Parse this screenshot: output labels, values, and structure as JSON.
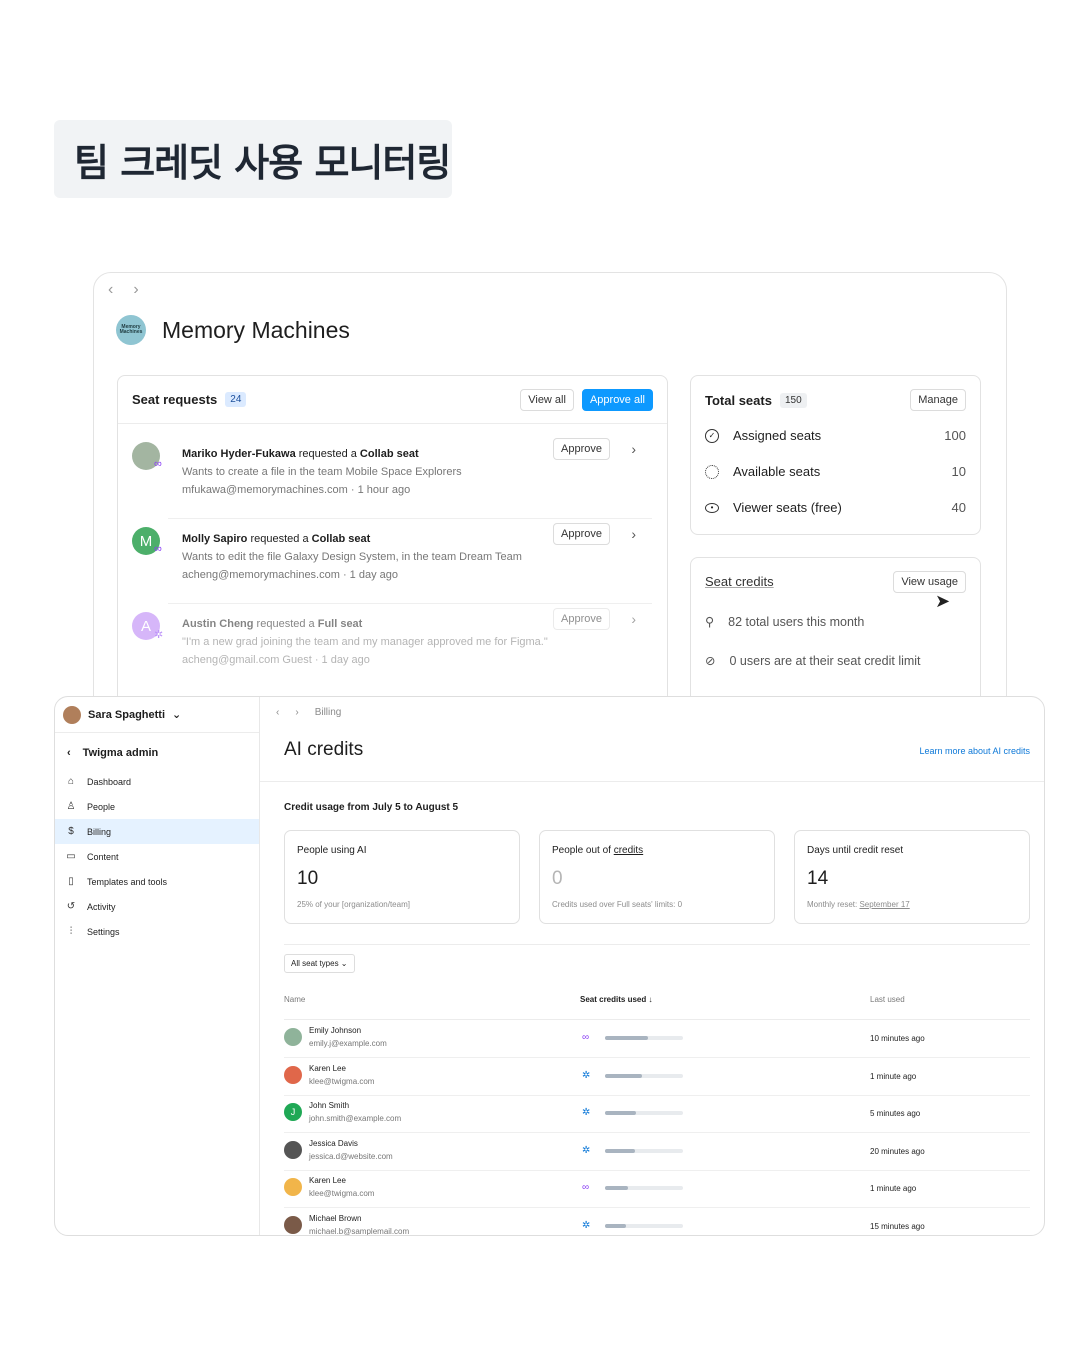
{
  "heading": "팀 크레딧 사용 모니터링",
  "back_window": {
    "nav": {
      "back": "‹",
      "forward": "›"
    },
    "org": {
      "logo_text": "Memory Machines",
      "name": "Memory Machines"
    },
    "seat_requests": {
      "title": "Seat requests",
      "count": "24",
      "view_all": "View all",
      "approve_all": "Approve all",
      "items": [
        {
          "name": "Mariko Hyder-Fukawa",
          "verb": " requested a ",
          "seat": "Collab seat",
          "note": "Wants to create a file in the team Mobile Space Explorers",
          "meta": "mfukawa@memorymachines.com · 1 hour ago",
          "approve": "Approve",
          "avatar_initial": "",
          "avatar_color": "#a3b5a1"
        },
        {
          "name": "Molly Sapiro",
          "verb": " requested a ",
          "seat": "Collab seat",
          "note": "Wants to edit the file Galaxy Design System, in the team Dream Team",
          "meta": "acheng@memorymachines.com · 1 day ago",
          "approve": "Approve",
          "avatar_initial": "M",
          "avatar_color": "#4caf6a"
        },
        {
          "name": "Austin Cheng",
          "verb": " requested a ",
          "seat": "Full seat",
          "note": "\"I'm a new grad joining the team and my manager approved me for Figma.\"",
          "meta": "acheng@gmail.com   Guest   · 1 day ago",
          "approve": "Approve",
          "avatar_initial": "A",
          "avatar_color": "#b57bf5"
        }
      ]
    },
    "total_seats": {
      "title": "Total seats",
      "count": "150",
      "manage": "Manage",
      "rows": [
        {
          "label": "Assigned seats",
          "value": "100",
          "icon": "check-circle-icon"
        },
        {
          "label": "Available seats",
          "value": "10",
          "icon": "dashed-circle-icon"
        },
        {
          "label": "Viewer seats (free)",
          "value": "40",
          "icon": "eye-icon"
        }
      ]
    },
    "seat_credits": {
      "title": "Seat credits",
      "view_usage": "View usage",
      "rows": [
        {
          "text": "82 total users this month",
          "icon": "user-icon"
        },
        {
          "text": "0 users are at their seat credit limit",
          "icon": "no-entry-icon"
        }
      ]
    }
  },
  "front_window": {
    "user": {
      "name": "Sara Spaghetti"
    },
    "sidebar": {
      "back_label": "Twigma admin",
      "items": [
        {
          "label": "Dashboard",
          "icon": "home-icon"
        },
        {
          "label": "People",
          "icon": "user-icon"
        },
        {
          "label": "Billing",
          "icon": "dollar-icon",
          "active": true
        },
        {
          "label": "Content",
          "icon": "folder-icon"
        },
        {
          "label": "Templates and tools",
          "icon": "book-icon"
        },
        {
          "label": "Activity",
          "icon": "history-icon"
        },
        {
          "label": "Settings",
          "icon": "sliders-icon"
        }
      ]
    },
    "breadcrumb": {
      "current": "Billing"
    },
    "title": "AI credits",
    "learn_more": "Learn more about AI credits",
    "usage_heading": "Credit usage from July 5 to August 5",
    "stats": [
      {
        "title": "People using AI",
        "value": "10",
        "desc": "25% of your [organization/team]"
      },
      {
        "title_prefix": "People out of ",
        "title_link": "credits",
        "value": "0",
        "desc": "Credits used over Full seats' limits: 0"
      },
      {
        "title": "Days until credit reset",
        "value": "14",
        "desc_prefix": "Monthly reset: ",
        "desc_link": "September 17"
      }
    ],
    "filter": "All seat types ⌄",
    "table": {
      "headers": {
        "name": "Name",
        "credits": "Seat credits used ↓",
        "last": "Last used"
      },
      "rows": [
        {
          "name": "Emily Johnson",
          "email": "emily.j@example.com",
          "seat_icon": "collab-seat-icon",
          "usage": 0.55,
          "last": "10 minutes ago",
          "initial": "",
          "avatar_color": "#8fb39a"
        },
        {
          "name": "Karen Lee",
          "email": "klee@twigma.com",
          "seat_icon": "full-seat-icon",
          "usage": 0.48,
          "last": "1 minute ago",
          "initial": "",
          "avatar_color": "#e0674a"
        },
        {
          "name": "John Smith",
          "email": "john.smith@example.com",
          "seat_icon": "full-seat-icon",
          "usage": 0.4,
          "last": "5 minutes ago",
          "initial": "J",
          "avatar_color": "#1fa855"
        },
        {
          "name": "Jessica Davis",
          "email": "jessica.d@website.com",
          "seat_icon": "full-seat-icon",
          "usage": 0.38,
          "last": "20 minutes ago",
          "initial": "",
          "avatar_color": "#555555"
        },
        {
          "name": "Karen Lee",
          "email": "klee@twigma.com",
          "seat_icon": "collab-seat-icon",
          "usage": 0.3,
          "last": "1 minute ago",
          "initial": "",
          "avatar_color": "#f1b54a"
        },
        {
          "name": "Michael Brown",
          "email": "michael.b@samplemail.com",
          "seat_icon": "full-seat-icon",
          "usage": 0.27,
          "last": "15 minutes ago",
          "initial": "",
          "avatar_color": "#7a5a48"
        }
      ]
    }
  }
}
